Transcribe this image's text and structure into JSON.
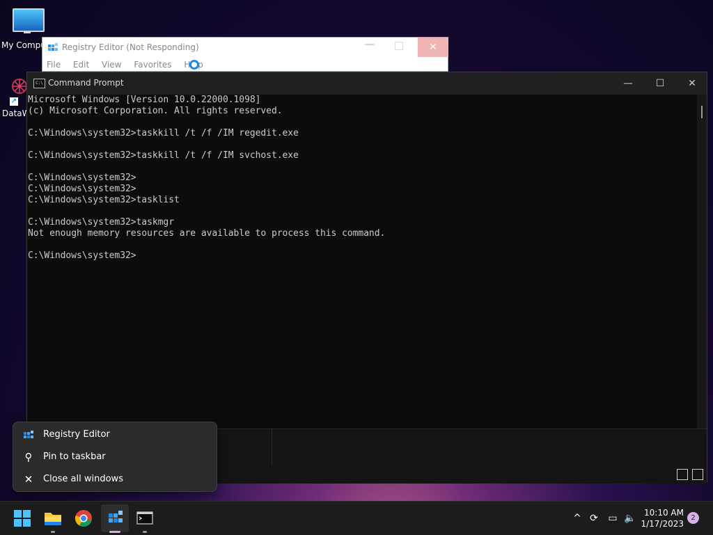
{
  "desktop": {
    "icons": [
      {
        "label": "My Compu"
      },
      {
        "label": "DataW"
      }
    ]
  },
  "regedit": {
    "title": "Registry Editor (Not Responding)",
    "menu": [
      "File",
      "Edit",
      "View",
      "Favorites",
      "Help"
    ]
  },
  "cmd": {
    "title": "Command Prompt",
    "lines": [
      "Microsoft Windows [Version 10.0.22000.1098]",
      "(c) Microsoft Corporation. All rights reserved.",
      "",
      "C:\\Windows\\system32>taskkill /t /f /IM regedit.exe",
      "",
      "C:\\Windows\\system32>taskkill /t /f /IM svchost.exe",
      "",
      "C:\\Windows\\system32>",
      "C:\\Windows\\system32>",
      "C:\\Windows\\system32>tasklist",
      "",
      "C:\\Windows\\system32>taskmgr",
      "Not enough memory resources are available to process this command.",
      "",
      "C:\\Windows\\system32>"
    ]
  },
  "jumplist": {
    "items": [
      {
        "label": "Registry Editor",
        "icon": "registry-editor-icon"
      },
      {
        "label": "Pin to taskbar",
        "icon": "pin-icon"
      },
      {
        "label": "Close all windows",
        "icon": "close-icon"
      }
    ]
  },
  "taskbar": {
    "apps": [
      {
        "name": "start",
        "icon": "windows-logo-icon"
      },
      {
        "name": "file-explorer",
        "icon": "folder-icon"
      },
      {
        "name": "chrome",
        "icon": "chrome-icon"
      },
      {
        "name": "registry-editor",
        "icon": "registry-editor-icon"
      },
      {
        "name": "command-prompt",
        "icon": "terminal-icon"
      }
    ],
    "time": "10:10 AM",
    "date": "1/17/2023",
    "notification_count": "2"
  },
  "colors": {
    "accent": "#1e88e5",
    "active_indicator": "#d6b0e6",
    "close_hover": "#f1b5b5"
  }
}
